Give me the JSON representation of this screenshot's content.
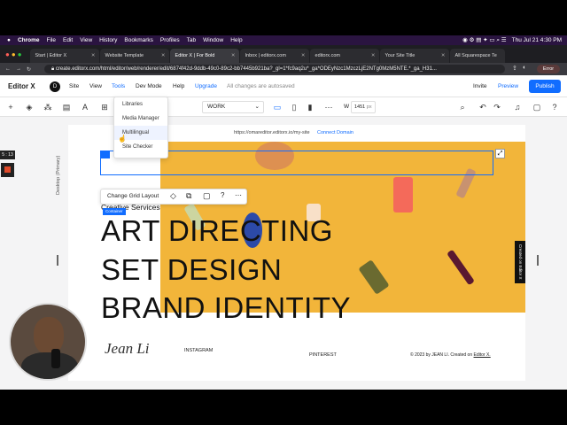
{
  "menubar": {
    "app": "Chrome",
    "items": [
      "File",
      "Edit",
      "View",
      "History",
      "Bookmarks",
      "Profiles",
      "Tab",
      "Window",
      "Help"
    ],
    "clock": "Thu Jul 21  4:30 PM"
  },
  "tabs": [
    {
      "label": "Start | Editor X",
      "active": false
    },
    {
      "label": "Website Template",
      "active": false
    },
    {
      "label": "Editor X | For Bold",
      "active": true
    },
    {
      "label": "Inbox | editorx.com",
      "active": false
    },
    {
      "label": "editorx.com",
      "active": false
    },
    {
      "label": "Your Site Title",
      "active": false
    },
    {
      "label": "All Squarespace Te",
      "active": false
    }
  ],
  "url": "create.editorx.com/html/editor/web/renderer/edit/6874f42d-9ddb-49c0-89c2-bb7445b921ba?_gl=1*fc9aq2u*_ga*ODEyNzc1MzczLjE2NTg0MzM5NTE.*_ga_H31...",
  "error_badge": "Error",
  "topbar": {
    "logo": "Editor X",
    "menu": [
      "Site",
      "View",
      "Tools",
      "Dev Mode",
      "Help",
      "Upgrade"
    ],
    "autosave": "All changes are autosaved",
    "invite": "Invite",
    "preview": "Preview",
    "publish": "Publish"
  },
  "toolbar2": {
    "page_select": "WORK",
    "width_label": "W",
    "width_value": "1451",
    "width_unit": "px"
  },
  "tools_menu": [
    "Libraries",
    "Media Manager",
    "Multilingual",
    "Site Checker"
  ],
  "canvas": {
    "site_url": "https://omareditor.editorx.io/my-site",
    "connect_domain": "Connect Domain",
    "vertical_label": "Desktop (Primary)",
    "breakpoint_badge": "5 : 13",
    "grid_popover_label": "Change Grid Layout",
    "container_tag": "Container",
    "subtitle": "Creative Services",
    "headline_lines": [
      "ART DIRECTING",
      "SET DESIGN",
      "BRAND IDENTITY"
    ],
    "signature": "Jean Li",
    "instagram": "INSTAGRAM",
    "pinterest": "PINTEREST",
    "copyright_text": "© 2023 by JEAN LI. Created on",
    "copyright_link": "Editor X.",
    "created_badge": "Created on Editor X"
  },
  "colors": {
    "menubar": "#2a1440",
    "accent": "#116dff",
    "hero": "#f2b53a"
  }
}
